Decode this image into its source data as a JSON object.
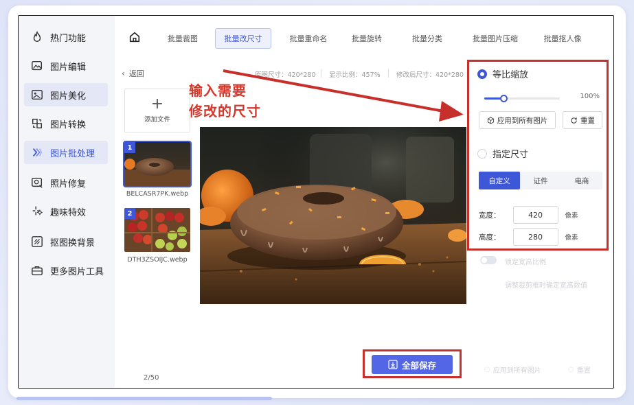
{
  "sidebar": {
    "items": [
      {
        "label": "热门功能",
        "icon": "flame-icon"
      },
      {
        "label": "图片编辑",
        "icon": "image-edit-icon"
      },
      {
        "label": "图片美化",
        "icon": "image-beautify-icon"
      },
      {
        "label": "图片转换",
        "icon": "image-convert-icon"
      },
      {
        "label": "图片批处理",
        "icon": "batch-process-icon"
      },
      {
        "label": "照片修复",
        "icon": "photo-repair-icon"
      },
      {
        "label": "趣味特效",
        "icon": "sparkle-icon"
      },
      {
        "label": "抠图换背景",
        "icon": "cutout-icon"
      },
      {
        "label": "更多图片工具",
        "icon": "toolbox-icon"
      }
    ]
  },
  "topnav": {
    "tabs": [
      "批量裁图",
      "批量改尺寸",
      "批量重命名",
      "批量旋转",
      "批量分类",
      "批量图片压缩",
      "批量抠人像"
    ],
    "active_index": 1
  },
  "back_label": "返回",
  "info": {
    "original_size": "原图尺寸：420*280",
    "display_ratio": "显示比例：457%",
    "modified_size": "修改后尺寸：420*280"
  },
  "add_file_label": "添加文件",
  "files": [
    {
      "num": "1",
      "name": "BELCASR7PK.webp"
    },
    {
      "num": "2",
      "name": "DTH3ZSOIJC.webp"
    }
  ],
  "page_count": "2/50",
  "annotation": {
    "line1": "输入需要",
    "line2": "修改的尺寸"
  },
  "right_panel": {
    "proportional_label": "等比缩放",
    "scale_percent": "100%",
    "scale_value": 0.25,
    "apply_all_label": "应用到所有图片",
    "reset_label": "重置",
    "fixed_size_label": "指定尺寸",
    "size_tabs": [
      "自定义",
      "证件",
      "电商"
    ],
    "width_label": "宽度：",
    "width_value": "420",
    "height_label": "高度：",
    "height_value": "280",
    "unit": "像素"
  },
  "faded": {
    "lock_ratio": "锁定宽高比例",
    "hint": "调整裁剪框时确定宽高数值",
    "apply_all": "应用到所有图片",
    "reset": "重置"
  },
  "save_label": "全部保存",
  "colors": {
    "accent": "#3d57d8",
    "highlight": "#c7302a",
    "save": "#5367e6"
  }
}
